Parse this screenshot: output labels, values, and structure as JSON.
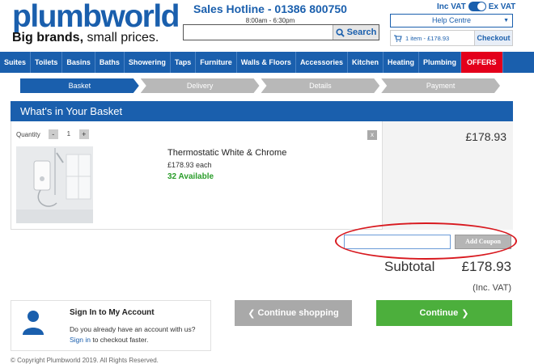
{
  "brand": {
    "logo": "plumbworld",
    "tagline_bold": "Big brands,",
    "tagline_rest": " small prices.",
    "color": "#1a5fad"
  },
  "hotline": {
    "title": "Sales Hotline - 01386 800750",
    "hours": "8:00am - 6:30pm"
  },
  "search": {
    "placeholder": "",
    "button_label": "Search",
    "icon": "search-icon"
  },
  "vat": {
    "inc_label": "Inc VAT",
    "ex_label": "Ex VAT"
  },
  "help": {
    "label": "Help Centre"
  },
  "cart": {
    "summary": "1 item - £178.93",
    "checkout_label": "Checkout",
    "icon": "basket-icon"
  },
  "nav": {
    "items": [
      "Suites",
      "Toilets",
      "Basins",
      "Baths",
      "Showering",
      "Taps",
      "Furniture",
      "Walls & Floors",
      "Accessories",
      "Kitchen",
      "Heating",
      "Plumbing"
    ],
    "offers": "OFFERS",
    "offers_color": "#e3001b"
  },
  "steps": {
    "items": [
      "Basket",
      "Delivery",
      "Details",
      "Payment"
    ],
    "active_index": 0
  },
  "basket": {
    "title": "What's in Your Basket",
    "quantity_label": "Quantity",
    "quantity_value": "1",
    "minus": "-",
    "plus": "+",
    "remove": "x",
    "product": {
      "name": "Thermostatic White & Chrome",
      "each_price": "£178.93 each",
      "availability": "32 Available"
    },
    "line_total": "£178.93"
  },
  "coupon": {
    "value": "",
    "button_label": "Add Coupon"
  },
  "totals": {
    "subtotal_label": "Subtotal",
    "subtotal_value": "£178.93",
    "vat_note": "(Inc. VAT)"
  },
  "signin": {
    "title": "Sign In to My Account",
    "question": "Do you already have an account with us?",
    "link": "Sign in",
    "after_link": " to checkout faster."
  },
  "actions": {
    "continue_shopping": "Continue shopping",
    "continue": "Continue"
  },
  "footer": {
    "copyright": "© Copyright Plumbworld 2019. All Rights Reserved."
  }
}
